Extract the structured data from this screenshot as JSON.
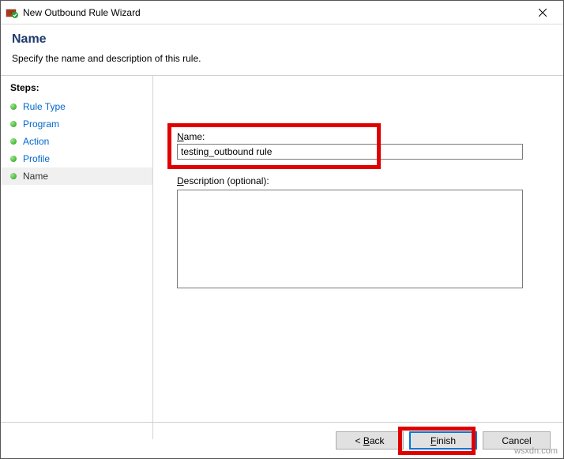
{
  "window_title": "New Outbound Rule Wizard",
  "header": {
    "title": "Name",
    "subtitle": "Specify the name and description of this rule."
  },
  "steps": {
    "header": "Steps:",
    "items": [
      {
        "label": "Rule Type",
        "current": false
      },
      {
        "label": "Program",
        "current": false
      },
      {
        "label": "Action",
        "current": false
      },
      {
        "label": "Profile",
        "current": false
      },
      {
        "label": "Name",
        "current": true
      }
    ]
  },
  "form": {
    "name_label_u": "N",
    "name_label_rest": "ame:",
    "name_value": "testing_outbound rule",
    "desc_label_u": "D",
    "desc_label_rest": "escription (optional):",
    "desc_value": ""
  },
  "buttons": {
    "back_pre": "< ",
    "back_u": "B",
    "back_rest": "ack",
    "finish_u": "F",
    "finish_rest": "inish",
    "cancel": "Cancel"
  },
  "watermark": "wsxdn.com"
}
